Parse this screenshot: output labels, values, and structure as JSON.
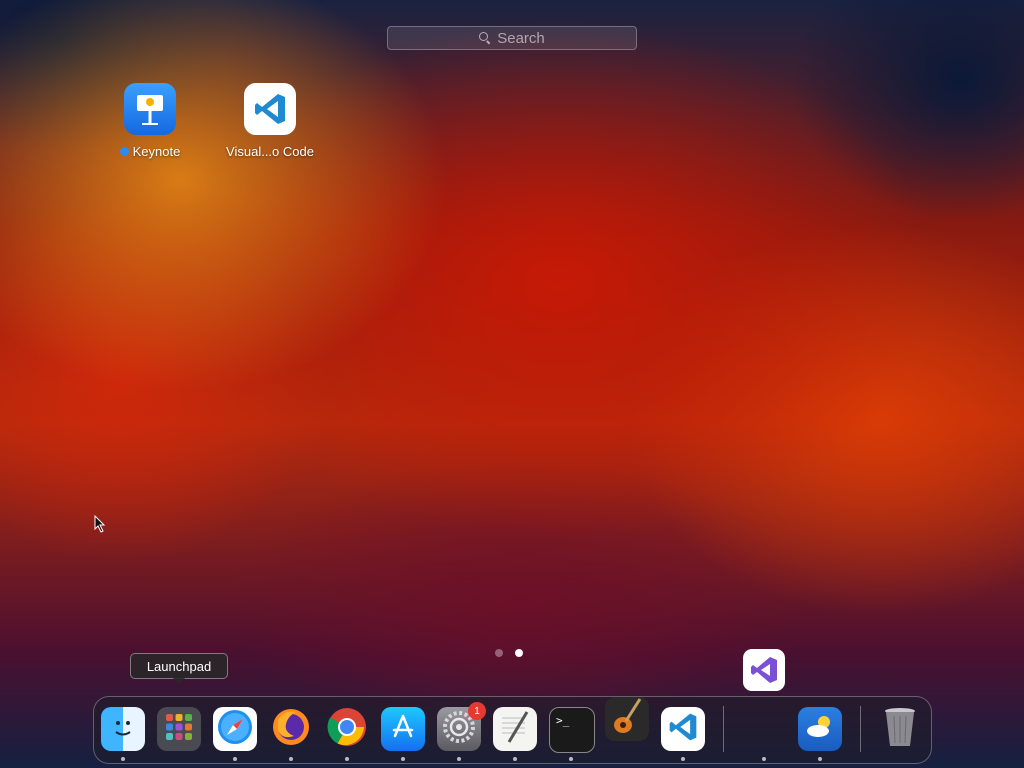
{
  "search": {
    "placeholder": "Search"
  },
  "apps": [
    {
      "name": "Keynote",
      "indicator": true
    },
    {
      "name": "Visual...o Code"
    }
  ],
  "page_indicator": {
    "pages": 2,
    "current": 2
  },
  "tooltip": {
    "label": "Launchpad"
  },
  "dock": {
    "items": [
      {
        "name": "Finder",
        "running": true
      },
      {
        "name": "Launchpad",
        "running": false
      },
      {
        "name": "Safari",
        "running": true
      },
      {
        "name": "Firefox",
        "running": true
      },
      {
        "name": "Google Chrome",
        "running": true
      },
      {
        "name": "App Store",
        "running": true
      },
      {
        "name": "System Preferences",
        "running": true,
        "badge": "1"
      },
      {
        "name": "TextEdit",
        "running": true
      },
      {
        "name": "Terminal",
        "running": true
      },
      {
        "name": "GarageBand",
        "running": false
      },
      {
        "name": "Visual Studio Code",
        "running": true
      },
      {
        "name": "Visual Studio",
        "running": true
      },
      {
        "name": "Weather",
        "running": true
      },
      {
        "name": "Trash",
        "running": false
      }
    ]
  },
  "colors": {
    "accent": "#2a8cf0",
    "badge": "#e53a2f"
  }
}
